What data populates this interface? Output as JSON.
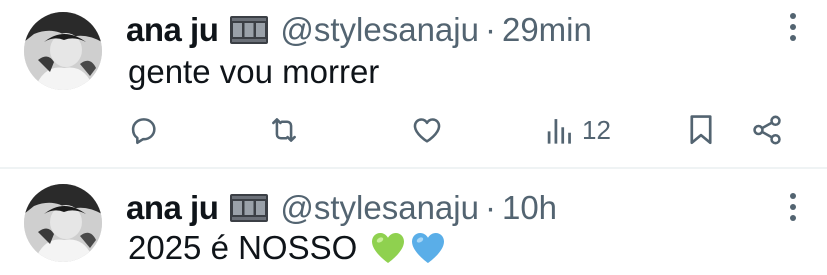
{
  "colors": {
    "text_primary": "#0f1419",
    "text_secondary": "#536471",
    "divider": "#eff3f4",
    "heart_green": "#8fd14f",
    "heart_blue": "#5aaee8"
  },
  "tweets": [
    {
      "author_name": "ana ju",
      "author_emoji": "film-frames-emoji",
      "handle": "@stylesanaju",
      "separator": "·",
      "time": "29min",
      "text": "gente vou morrer",
      "text_emojis": [],
      "actions": {
        "reply_icon": "reply-icon",
        "retweet_icon": "retweet-icon",
        "like_icon": "heart-icon",
        "views_icon": "views-icon",
        "views_count": "12",
        "bookmark_icon": "bookmark-icon",
        "share_icon": "share-icon"
      }
    },
    {
      "author_name": "ana ju",
      "author_emoji": "film-frames-emoji",
      "handle": "@stylesanaju",
      "separator": "·",
      "time": "10h",
      "text": "2025 é NOSSO",
      "text_emojis": [
        "green-heart-emoji",
        "blue-heart-emoji"
      ]
    }
  ]
}
